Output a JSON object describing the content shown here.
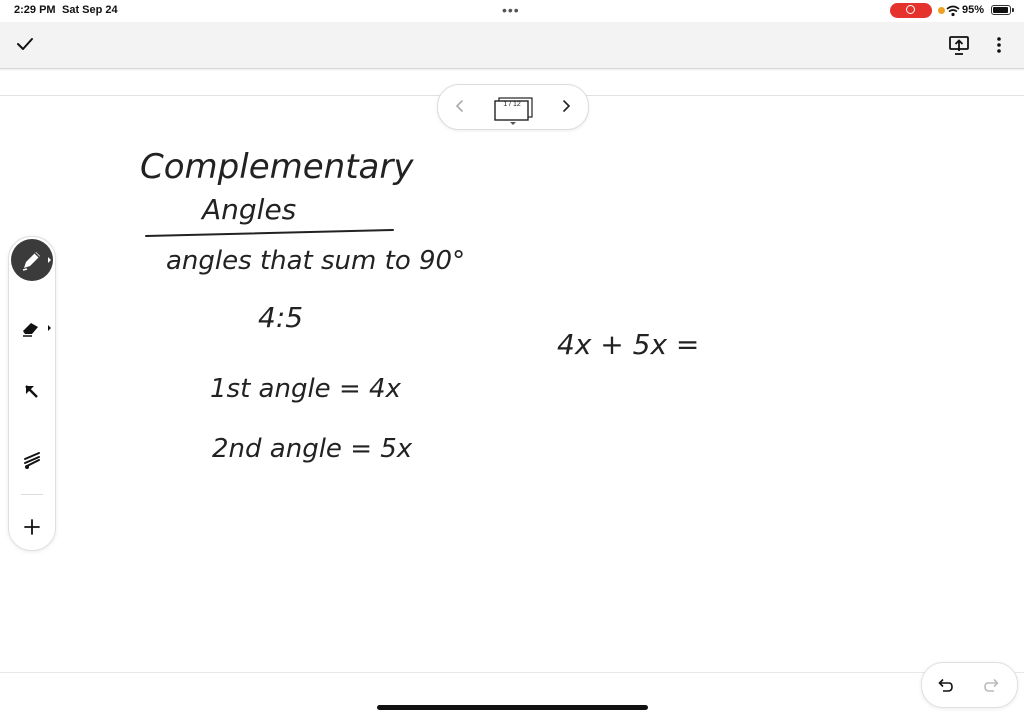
{
  "status_bar": {
    "time": "2:29 PM",
    "date": "Sat Sep 24",
    "battery_percent": "95%",
    "battery_level": 0.95,
    "recording": true
  },
  "toolbar": {
    "done_icon": "check-icon",
    "present_icon": "present-screen-icon",
    "more_icon": "more-vertical-icon"
  },
  "pager": {
    "count": "1 / 12",
    "current_page": 1,
    "total_pages": 12
  },
  "tools": [
    "pen-icon",
    "eraser-icon",
    "select-arrow-icon",
    "laser-pointer-icon",
    "add-icon"
  ],
  "handwriting": {
    "title_line1": "Complementary",
    "title_line2": "Angles",
    "definition": "angles that sum to 90°",
    "ratio": "4:5",
    "first_angle": "1st angle = 4x",
    "second_angle": "2nd angle = 5x",
    "equation": "4x + 5x ="
  },
  "colors": {
    "accent_record": "#e5322d",
    "active_tool": "#3b3b3b",
    "toolbar_bg": "#f3f3f3"
  }
}
